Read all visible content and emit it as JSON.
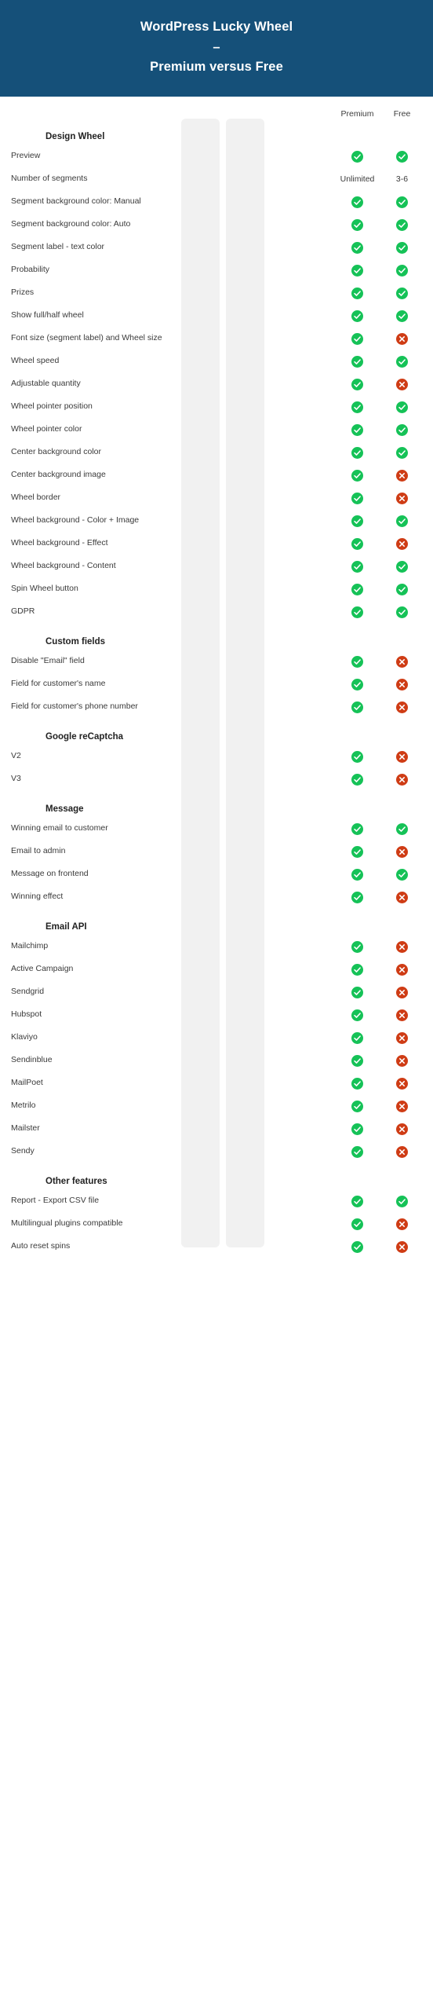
{
  "banner": {
    "title_line1": "WordPress Lucky Wheel",
    "title_dash": "–",
    "title_line2": "Premium versus Free"
  },
  "columns": {
    "premium_label": "Premium",
    "free_label": "Free"
  },
  "colors": {
    "banner_bg": "#155079",
    "column_band": "#f1f1f1",
    "check_green": "#15c257",
    "cross_red": "#cf3c15",
    "page_bg": "#ffffff"
  },
  "icons": {
    "check": "check-circle-icon",
    "cross": "cross-circle-icon"
  },
  "sections": [
    {
      "heading": "Design Wheel",
      "rows": [
        {
          "label": "Preview",
          "premium": "check",
          "free": "check"
        },
        {
          "label": "Number of segments",
          "premium": "Unlimited",
          "free": "3-6"
        },
        {
          "label": "Segment background color: Manual",
          "premium": "check",
          "free": "check"
        },
        {
          "label": "Segment background color: Auto",
          "premium": "check",
          "free": "check"
        },
        {
          "label": "Segment label - text color",
          "premium": "check",
          "free": "check"
        },
        {
          "label": "Probability",
          "premium": "check",
          "free": "check"
        },
        {
          "label": "Prizes",
          "premium": "check",
          "free": "check"
        },
        {
          "label": "Show full/half wheel",
          "premium": "check",
          "free": "check"
        },
        {
          "label": "Font size (segment label) and Wheel size",
          "premium": "check",
          "free": "cross"
        },
        {
          "label": "Wheel speed",
          "premium": "check",
          "free": "check"
        },
        {
          "label": "Adjustable quantity",
          "premium": "check",
          "free": "cross"
        },
        {
          "label": "Wheel pointer position",
          "premium": "check",
          "free": "check"
        },
        {
          "label": "Wheel pointer color",
          "premium": "check",
          "free": "check"
        },
        {
          "label": "Center background color",
          "premium": "check",
          "free": "check"
        },
        {
          "label": "Center background image",
          "premium": "check",
          "free": "cross"
        },
        {
          "label": "Wheel border",
          "premium": "check",
          "free": "cross"
        },
        {
          "label": "Wheel background - Color + Image",
          "premium": "check",
          "free": "check"
        },
        {
          "label": "Wheel background - Effect",
          "premium": "check",
          "free": "cross"
        },
        {
          "label": "Wheel background - Content",
          "premium": "check",
          "free": "check"
        },
        {
          "label": "Spin Wheel button",
          "premium": "check",
          "free": "check"
        },
        {
          "label": "GDPR",
          "premium": "check",
          "free": "check"
        }
      ]
    },
    {
      "heading": "Custom fields",
      "rows": [
        {
          "label": "Disable \"Email\" field",
          "premium": "check",
          "free": "cross"
        },
        {
          "label": "Field for customer's name",
          "premium": "check",
          "free": "cross"
        },
        {
          "label": "Field for customer's phone number",
          "premium": "check",
          "free": "cross"
        }
      ]
    },
    {
      "heading": "Google reCaptcha",
      "rows": [
        {
          "label": "V2",
          "premium": "check",
          "free": "cross"
        },
        {
          "label": "V3",
          "premium": "check",
          "free": "cross"
        }
      ]
    },
    {
      "heading": "Message",
      "rows": [
        {
          "label": "Winning email to customer",
          "premium": "check",
          "free": "check"
        },
        {
          "label": "Email to admin",
          "premium": "check",
          "free": "cross"
        },
        {
          "label": "Message on frontend",
          "premium": "check",
          "free": "check"
        },
        {
          "label": "Winning effect",
          "premium": "check",
          "free": "cross"
        }
      ]
    },
    {
      "heading": "Email API",
      "rows": [
        {
          "label": "Mailchimp",
          "premium": "check",
          "free": "cross"
        },
        {
          "label": "Active Campaign",
          "premium": "check",
          "free": "cross"
        },
        {
          "label": "Sendgrid",
          "premium": "check",
          "free": "cross"
        },
        {
          "label": "Hubspot",
          "premium": "check",
          "free": "cross"
        },
        {
          "label": "Klaviyo",
          "premium": "check",
          "free": "cross"
        },
        {
          "label": "Sendinblue",
          "premium": "check",
          "free": "cross"
        },
        {
          "label": "MailPoet",
          "premium": "check",
          "free": "cross"
        },
        {
          "label": "Metrilo",
          "premium": "check",
          "free": "cross"
        },
        {
          "label": "Mailster",
          "premium": "check",
          "free": "cross"
        },
        {
          "label": "Sendy",
          "premium": "check",
          "free": "cross"
        }
      ]
    },
    {
      "heading": "Other features",
      "rows": [
        {
          "label": "Report - Export CSV file",
          "premium": "check",
          "free": "check"
        },
        {
          "label": "Multilingual plugins compatible",
          "premium": "check",
          "free": "cross"
        },
        {
          "label": "Auto reset spins",
          "premium": "check",
          "free": "cross"
        }
      ]
    }
  ]
}
